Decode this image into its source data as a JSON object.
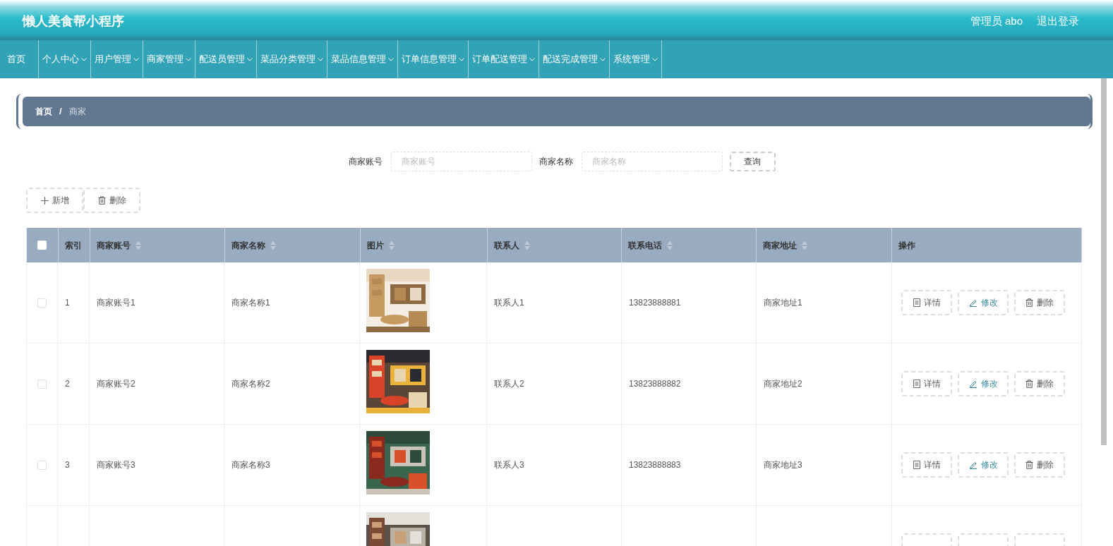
{
  "header": {
    "title": "懒人美食帮小程序",
    "user": "管理员 abo",
    "logout": "退出登录"
  },
  "nav": [
    {
      "label": "首页",
      "dropdown": false
    },
    {
      "label": "个人中心",
      "dropdown": true
    },
    {
      "label": "用户管理",
      "dropdown": true
    },
    {
      "label": "商家管理",
      "dropdown": true
    },
    {
      "label": "配送员管理",
      "dropdown": true
    },
    {
      "label": "菜品分类管理",
      "dropdown": true
    },
    {
      "label": "菜品信息管理",
      "dropdown": true
    },
    {
      "label": "订单信息管理",
      "dropdown": true
    },
    {
      "label": "订单配送管理",
      "dropdown": true
    },
    {
      "label": "配送完成管理",
      "dropdown": true
    },
    {
      "label": "系统管理",
      "dropdown": true
    }
  ],
  "breadcrumb": {
    "items": [
      "首页",
      "商家"
    ],
    "separator": "/"
  },
  "search": {
    "fields": [
      {
        "label": "商家账号",
        "placeholder": "商家账号"
      },
      {
        "label": "商家名称",
        "placeholder": "商家名称"
      }
    ],
    "button": "查询"
  },
  "toolbar": [
    {
      "kind": "add",
      "label": "新增"
    },
    {
      "kind": "delete",
      "label": "删除"
    }
  ],
  "table": {
    "columns": [
      {
        "label": "索引",
        "sortable": false
      },
      {
        "label": "商家账号",
        "sortable": true
      },
      {
        "label": "商家名称",
        "sortable": true
      },
      {
        "label": "图片",
        "sortable": true
      },
      {
        "label": "联系人",
        "sortable": true
      },
      {
        "label": "联系电话",
        "sortable": true
      },
      {
        "label": "商家地址",
        "sortable": true
      },
      {
        "label": "操作",
        "sortable": false
      }
    ],
    "select_all": {
      "checked": false
    },
    "rows": [
      {
        "checked": false,
        "cells": [
          "1",
          "商家账号1",
          "商家名称1",
          {
            "kind": "picture"
          },
          "联系人1",
          "13823888881",
          "商家地址1"
        ],
        "actions": [
          {
            "kind": "detail",
            "label": "详情"
          },
          {
            "kind": "edit",
            "label": "修改"
          },
          {
            "kind": "delete",
            "label": "删除"
          }
        ]
      },
      {
        "checked": false,
        "cells": [
          "2",
          "商家账号2",
          "商家名称2",
          {
            "kind": "picture"
          },
          "联系人2",
          "13823888882",
          "商家地址2"
        ],
        "actions": [
          {
            "kind": "detail",
            "label": "详情"
          },
          {
            "kind": "edit",
            "label": "修改"
          },
          {
            "kind": "delete",
            "label": "删除"
          }
        ]
      },
      {
        "checked": false,
        "cells": [
          "3",
          "商家账号3",
          "商家名称3",
          {
            "kind": "picture"
          },
          "联系人3",
          "13823888883",
          "商家地址3"
        ],
        "actions": [
          {
            "kind": "detail",
            "label": "详情"
          },
          {
            "kind": "edit",
            "label": "修改"
          },
          {
            "kind": "delete",
            "label": "删除"
          }
        ]
      },
      {
        "cells": [
          {
            "kind": "picture"
          }
        ]
      }
    ]
  }
}
